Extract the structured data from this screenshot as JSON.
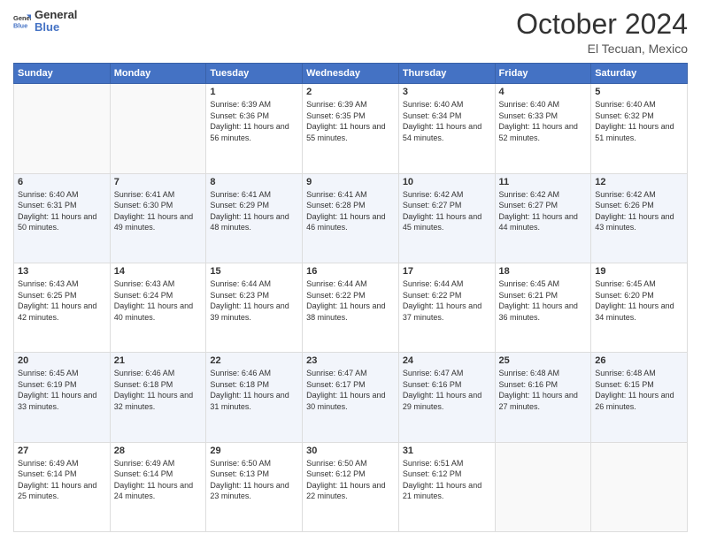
{
  "header": {
    "logo_line1": "General",
    "logo_line2": "Blue",
    "month": "October 2024",
    "location": "El Tecuan, Mexico"
  },
  "weekdays": [
    "Sunday",
    "Monday",
    "Tuesday",
    "Wednesday",
    "Thursday",
    "Friday",
    "Saturday"
  ],
  "weeks": [
    [
      {
        "day": "",
        "info": ""
      },
      {
        "day": "",
        "info": ""
      },
      {
        "day": "1",
        "info": "Sunrise: 6:39 AM\nSunset: 6:36 PM\nDaylight: 11 hours and 56 minutes."
      },
      {
        "day": "2",
        "info": "Sunrise: 6:39 AM\nSunset: 6:35 PM\nDaylight: 11 hours and 55 minutes."
      },
      {
        "day": "3",
        "info": "Sunrise: 6:40 AM\nSunset: 6:34 PM\nDaylight: 11 hours and 54 minutes."
      },
      {
        "day": "4",
        "info": "Sunrise: 6:40 AM\nSunset: 6:33 PM\nDaylight: 11 hours and 52 minutes."
      },
      {
        "day": "5",
        "info": "Sunrise: 6:40 AM\nSunset: 6:32 PM\nDaylight: 11 hours and 51 minutes."
      }
    ],
    [
      {
        "day": "6",
        "info": "Sunrise: 6:40 AM\nSunset: 6:31 PM\nDaylight: 11 hours and 50 minutes."
      },
      {
        "day": "7",
        "info": "Sunrise: 6:41 AM\nSunset: 6:30 PM\nDaylight: 11 hours and 49 minutes."
      },
      {
        "day": "8",
        "info": "Sunrise: 6:41 AM\nSunset: 6:29 PM\nDaylight: 11 hours and 48 minutes."
      },
      {
        "day": "9",
        "info": "Sunrise: 6:41 AM\nSunset: 6:28 PM\nDaylight: 11 hours and 46 minutes."
      },
      {
        "day": "10",
        "info": "Sunrise: 6:42 AM\nSunset: 6:27 PM\nDaylight: 11 hours and 45 minutes."
      },
      {
        "day": "11",
        "info": "Sunrise: 6:42 AM\nSunset: 6:27 PM\nDaylight: 11 hours and 44 minutes."
      },
      {
        "day": "12",
        "info": "Sunrise: 6:42 AM\nSunset: 6:26 PM\nDaylight: 11 hours and 43 minutes."
      }
    ],
    [
      {
        "day": "13",
        "info": "Sunrise: 6:43 AM\nSunset: 6:25 PM\nDaylight: 11 hours and 42 minutes."
      },
      {
        "day": "14",
        "info": "Sunrise: 6:43 AM\nSunset: 6:24 PM\nDaylight: 11 hours and 40 minutes."
      },
      {
        "day": "15",
        "info": "Sunrise: 6:44 AM\nSunset: 6:23 PM\nDaylight: 11 hours and 39 minutes."
      },
      {
        "day": "16",
        "info": "Sunrise: 6:44 AM\nSunset: 6:22 PM\nDaylight: 11 hours and 38 minutes."
      },
      {
        "day": "17",
        "info": "Sunrise: 6:44 AM\nSunset: 6:22 PM\nDaylight: 11 hours and 37 minutes."
      },
      {
        "day": "18",
        "info": "Sunrise: 6:45 AM\nSunset: 6:21 PM\nDaylight: 11 hours and 36 minutes."
      },
      {
        "day": "19",
        "info": "Sunrise: 6:45 AM\nSunset: 6:20 PM\nDaylight: 11 hours and 34 minutes."
      }
    ],
    [
      {
        "day": "20",
        "info": "Sunrise: 6:45 AM\nSunset: 6:19 PM\nDaylight: 11 hours and 33 minutes."
      },
      {
        "day": "21",
        "info": "Sunrise: 6:46 AM\nSunset: 6:18 PM\nDaylight: 11 hours and 32 minutes."
      },
      {
        "day": "22",
        "info": "Sunrise: 6:46 AM\nSunset: 6:18 PM\nDaylight: 11 hours and 31 minutes."
      },
      {
        "day": "23",
        "info": "Sunrise: 6:47 AM\nSunset: 6:17 PM\nDaylight: 11 hours and 30 minutes."
      },
      {
        "day": "24",
        "info": "Sunrise: 6:47 AM\nSunset: 6:16 PM\nDaylight: 11 hours and 29 minutes."
      },
      {
        "day": "25",
        "info": "Sunrise: 6:48 AM\nSunset: 6:16 PM\nDaylight: 11 hours and 27 minutes."
      },
      {
        "day": "26",
        "info": "Sunrise: 6:48 AM\nSunset: 6:15 PM\nDaylight: 11 hours and 26 minutes."
      }
    ],
    [
      {
        "day": "27",
        "info": "Sunrise: 6:49 AM\nSunset: 6:14 PM\nDaylight: 11 hours and 25 minutes."
      },
      {
        "day": "28",
        "info": "Sunrise: 6:49 AM\nSunset: 6:14 PM\nDaylight: 11 hours and 24 minutes."
      },
      {
        "day": "29",
        "info": "Sunrise: 6:50 AM\nSunset: 6:13 PM\nDaylight: 11 hours and 23 minutes."
      },
      {
        "day": "30",
        "info": "Sunrise: 6:50 AM\nSunset: 6:12 PM\nDaylight: 11 hours and 22 minutes."
      },
      {
        "day": "31",
        "info": "Sunrise: 6:51 AM\nSunset: 6:12 PM\nDaylight: 11 hours and 21 minutes."
      },
      {
        "day": "",
        "info": ""
      },
      {
        "day": "",
        "info": ""
      }
    ]
  ]
}
